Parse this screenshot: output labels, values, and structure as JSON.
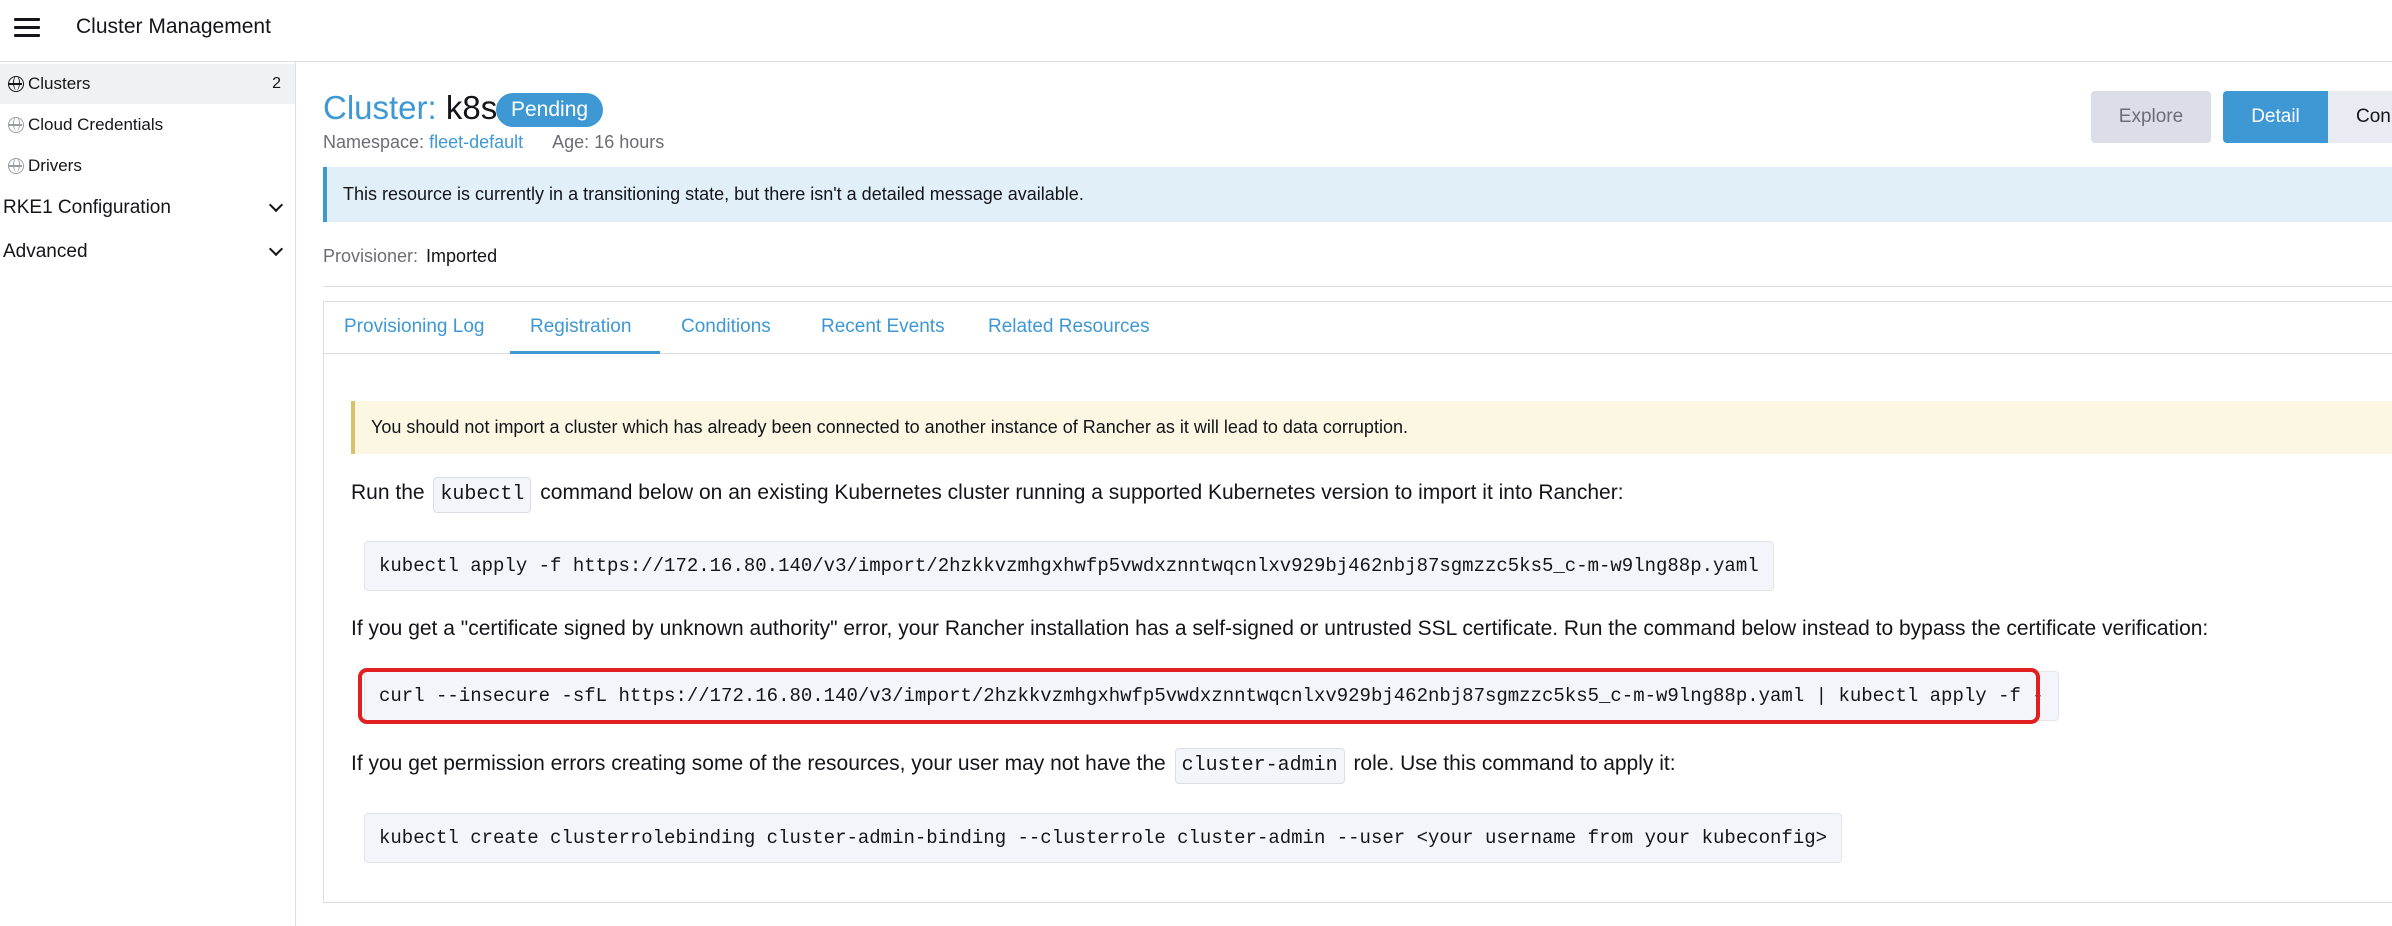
{
  "header": {
    "title": "Cluster Management",
    "menu_icon": "hamburger-menu-icon"
  },
  "sidebar": {
    "items": [
      {
        "label": "Clusters",
        "count": "2",
        "icon": "globe-icon",
        "active": true
      },
      {
        "label": "Cloud Credentials",
        "icon": "globe-icon"
      },
      {
        "label": "Drivers",
        "icon": "globe-icon"
      }
    ],
    "groups": [
      {
        "label": "RKE1 Configuration"
      },
      {
        "label": "Advanced"
      }
    ]
  },
  "page": {
    "title_label": "Cluster:",
    "title_name": "k8s",
    "status_badge": "Pending",
    "namespace_label": "Namespace:",
    "namespace_value": "fleet-default",
    "age_label": "Age:",
    "age_value": "16 hours",
    "buttons": {
      "explore": "Explore",
      "detail": "Detail",
      "config": "Con"
    },
    "info_banner": "This resource is currently in a transitioning state, but there isn't a detailed message available.",
    "provisioner_label": "Provisioner:",
    "provisioner_value": "Imported"
  },
  "tabs": [
    {
      "label": "Provisioning Log"
    },
    {
      "label": "Registration",
      "active": true
    },
    {
      "label": "Conditions"
    },
    {
      "label": "Recent Events"
    },
    {
      "label": "Related Resources"
    }
  ],
  "registration": {
    "warning": "You should not import a cluster which has already been connected to another instance of Rancher as it will lead to data corruption.",
    "run_prefix": "Run the",
    "run_code": "kubectl",
    "run_suffix": "command below on an existing Kubernetes cluster running a supported Kubernetes version to import it into Rancher:",
    "cmd_apply": "kubectl apply -f https://172.16.80.140/v3/import/2hzkkvzmhgxhwfp5vwdxznntwqcnlxv929bj462nbj87sgmzzc5ks5_c-m-w9lng88p.yaml",
    "cert_text": "If you get a \"certificate signed by unknown authority\" error, your Rancher installation has a self-signed or untrusted SSL certificate. Run the command below instead to bypass the certificate verification:",
    "cmd_curl": "curl --insecure -sfL https://172.16.80.140/v3/import/2hzkkvzmhgxhwfp5vwdxznntwqcnlxv929bj462nbj87sgmzzc5ks5_c-m-w9lng88p.yaml | kubectl apply -f -",
    "perm_prefix": "If you get permission errors creating some of the resources, your user may not have the",
    "perm_code": "cluster-admin",
    "perm_suffix": "role. Use this command to apply it:",
    "cmd_binding": "kubectl create clusterrolebinding cluster-admin-binding --clusterrole cluster-admin --user <your username from your kubeconfig>"
  },
  "colors": {
    "accent": "#3d98d3",
    "highlight": "#e02020",
    "warning_border": "#d9c06b"
  }
}
